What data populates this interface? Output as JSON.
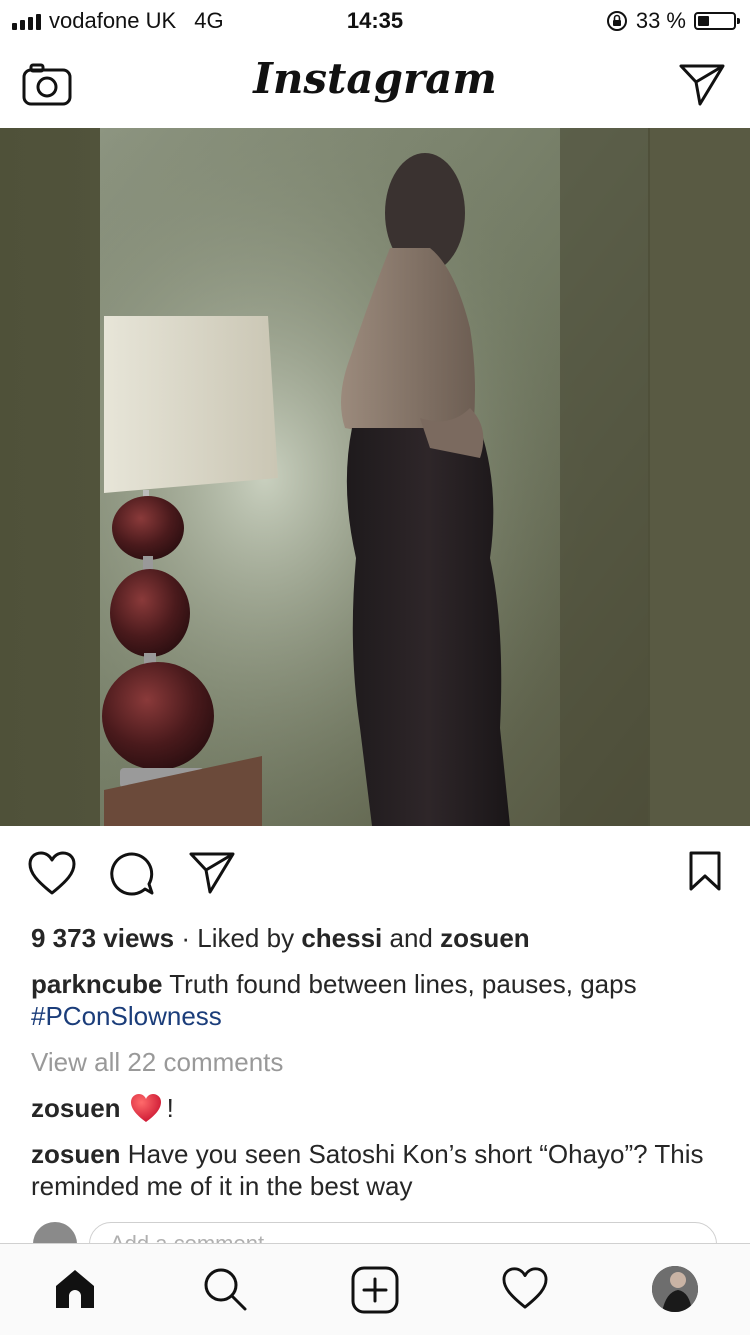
{
  "status_bar": {
    "carrier": "vodafone UK",
    "network": "4G",
    "time": "14:35",
    "battery_percent": "33 %",
    "battery_level": 0.33
  },
  "header": {
    "title": "Instagram",
    "left_icon": "camera-icon",
    "right_icon": "direct-message-icon"
  },
  "post": {
    "views_count": "9 373 views",
    "separator": " · ",
    "liked_prefix": "Liked by ",
    "liked_user1": "chessi",
    "liked_and": " and ",
    "liked_user2": "zosuen",
    "caption_user": "parkncube",
    "caption_text": " Truth found between lines, pauses, gaps",
    "hashtag": "#PConSlowness",
    "view_all_comments": "View all 22 comments",
    "comments": [
      {
        "user": "zosuen",
        "text_suffix": "!",
        "emoji": "red-heart-icon"
      },
      {
        "user": "zosuen",
        "text": " Have you seen Satoshi Kon’s short “Ohayo”? This reminded me of it in the best way"
      }
    ],
    "add_comment_placeholder": "Add a comment..."
  },
  "tabbar": {
    "items": [
      "home-icon",
      "search-icon",
      "new-post-icon",
      "activity-icon",
      "profile-avatar"
    ]
  },
  "colors": {
    "hashtag": "#1b3d7a",
    "muted": "#999999",
    "text": "#262626",
    "heart_emoji": "#e0245e"
  }
}
